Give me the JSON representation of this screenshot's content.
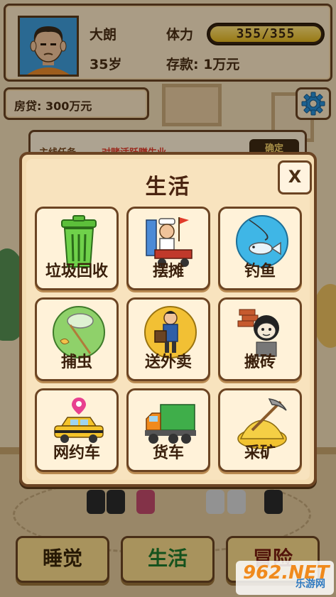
{
  "player": {
    "name": "大朗",
    "age": "35岁",
    "stamina_label": "体力",
    "stamina_text": "355/355",
    "stamina_value": 355,
    "stamina_max": 355,
    "savings": "存款: 1万元"
  },
  "loan": {
    "text": "房贷: 300万元"
  },
  "settings": {
    "icon": "gear-icon"
  },
  "quest": {
    "label": "主线任务",
    "text": "对赌活跃赚生业",
    "button": "确定"
  },
  "modal": {
    "title": "生活",
    "close_label": "X",
    "tiles": [
      {
        "label": "垃圾回收",
        "icon": "trash-bin-icon"
      },
      {
        "label": "摆摊",
        "icon": "street-vendor-icon"
      },
      {
        "label": "钓鱼",
        "icon": "fishing-icon"
      },
      {
        "label": "捕虫",
        "icon": "bug-net-icon"
      },
      {
        "label": "送外卖",
        "icon": "delivery-icon"
      },
      {
        "label": "搬砖",
        "icon": "brick-carrying-icon"
      },
      {
        "label": "网约车",
        "icon": "taxi-icon"
      },
      {
        "label": "货车",
        "icon": "truck-icon"
      },
      {
        "label": "采矿",
        "icon": "pickaxe-gold-icon"
      }
    ]
  },
  "bottom_nav": {
    "sleep": "睡觉",
    "life": "生活",
    "adventure": "冒险"
  },
  "watermark": {
    "big": "962.NET",
    "small": "乐游网"
  },
  "colors": {
    "panel_bg": "#fbe6c4",
    "border": "#6b4423",
    "stamina_fill": "#e2b51f",
    "life_green": "#1f7a2c"
  }
}
